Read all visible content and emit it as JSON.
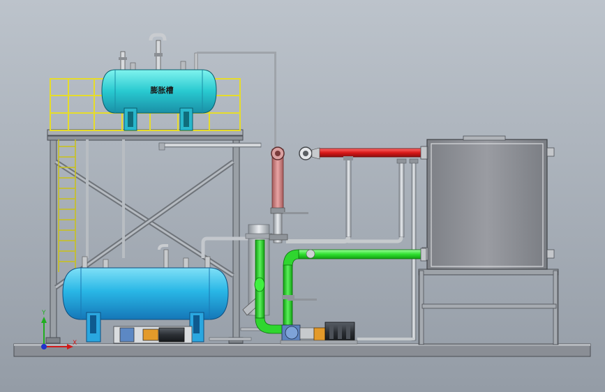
{
  "expansion_tank": {
    "label": "膨胀槽"
  },
  "axis_triad": {
    "y_label": "Y",
    "x_label": "X"
  },
  "colors": {
    "background_top": "#b9c0c8",
    "background_bottom": "#949ca6",
    "tank_body": "#2bb8e6",
    "hot_pipe": "#e02020",
    "return_pipe": "#27e327",
    "pink_pipe": "#d98b8b",
    "railing": "#e6dc2a",
    "frame_steel": "#8a8f96",
    "heater_body": "#8e9096",
    "motor": "#2a2e33"
  }
}
